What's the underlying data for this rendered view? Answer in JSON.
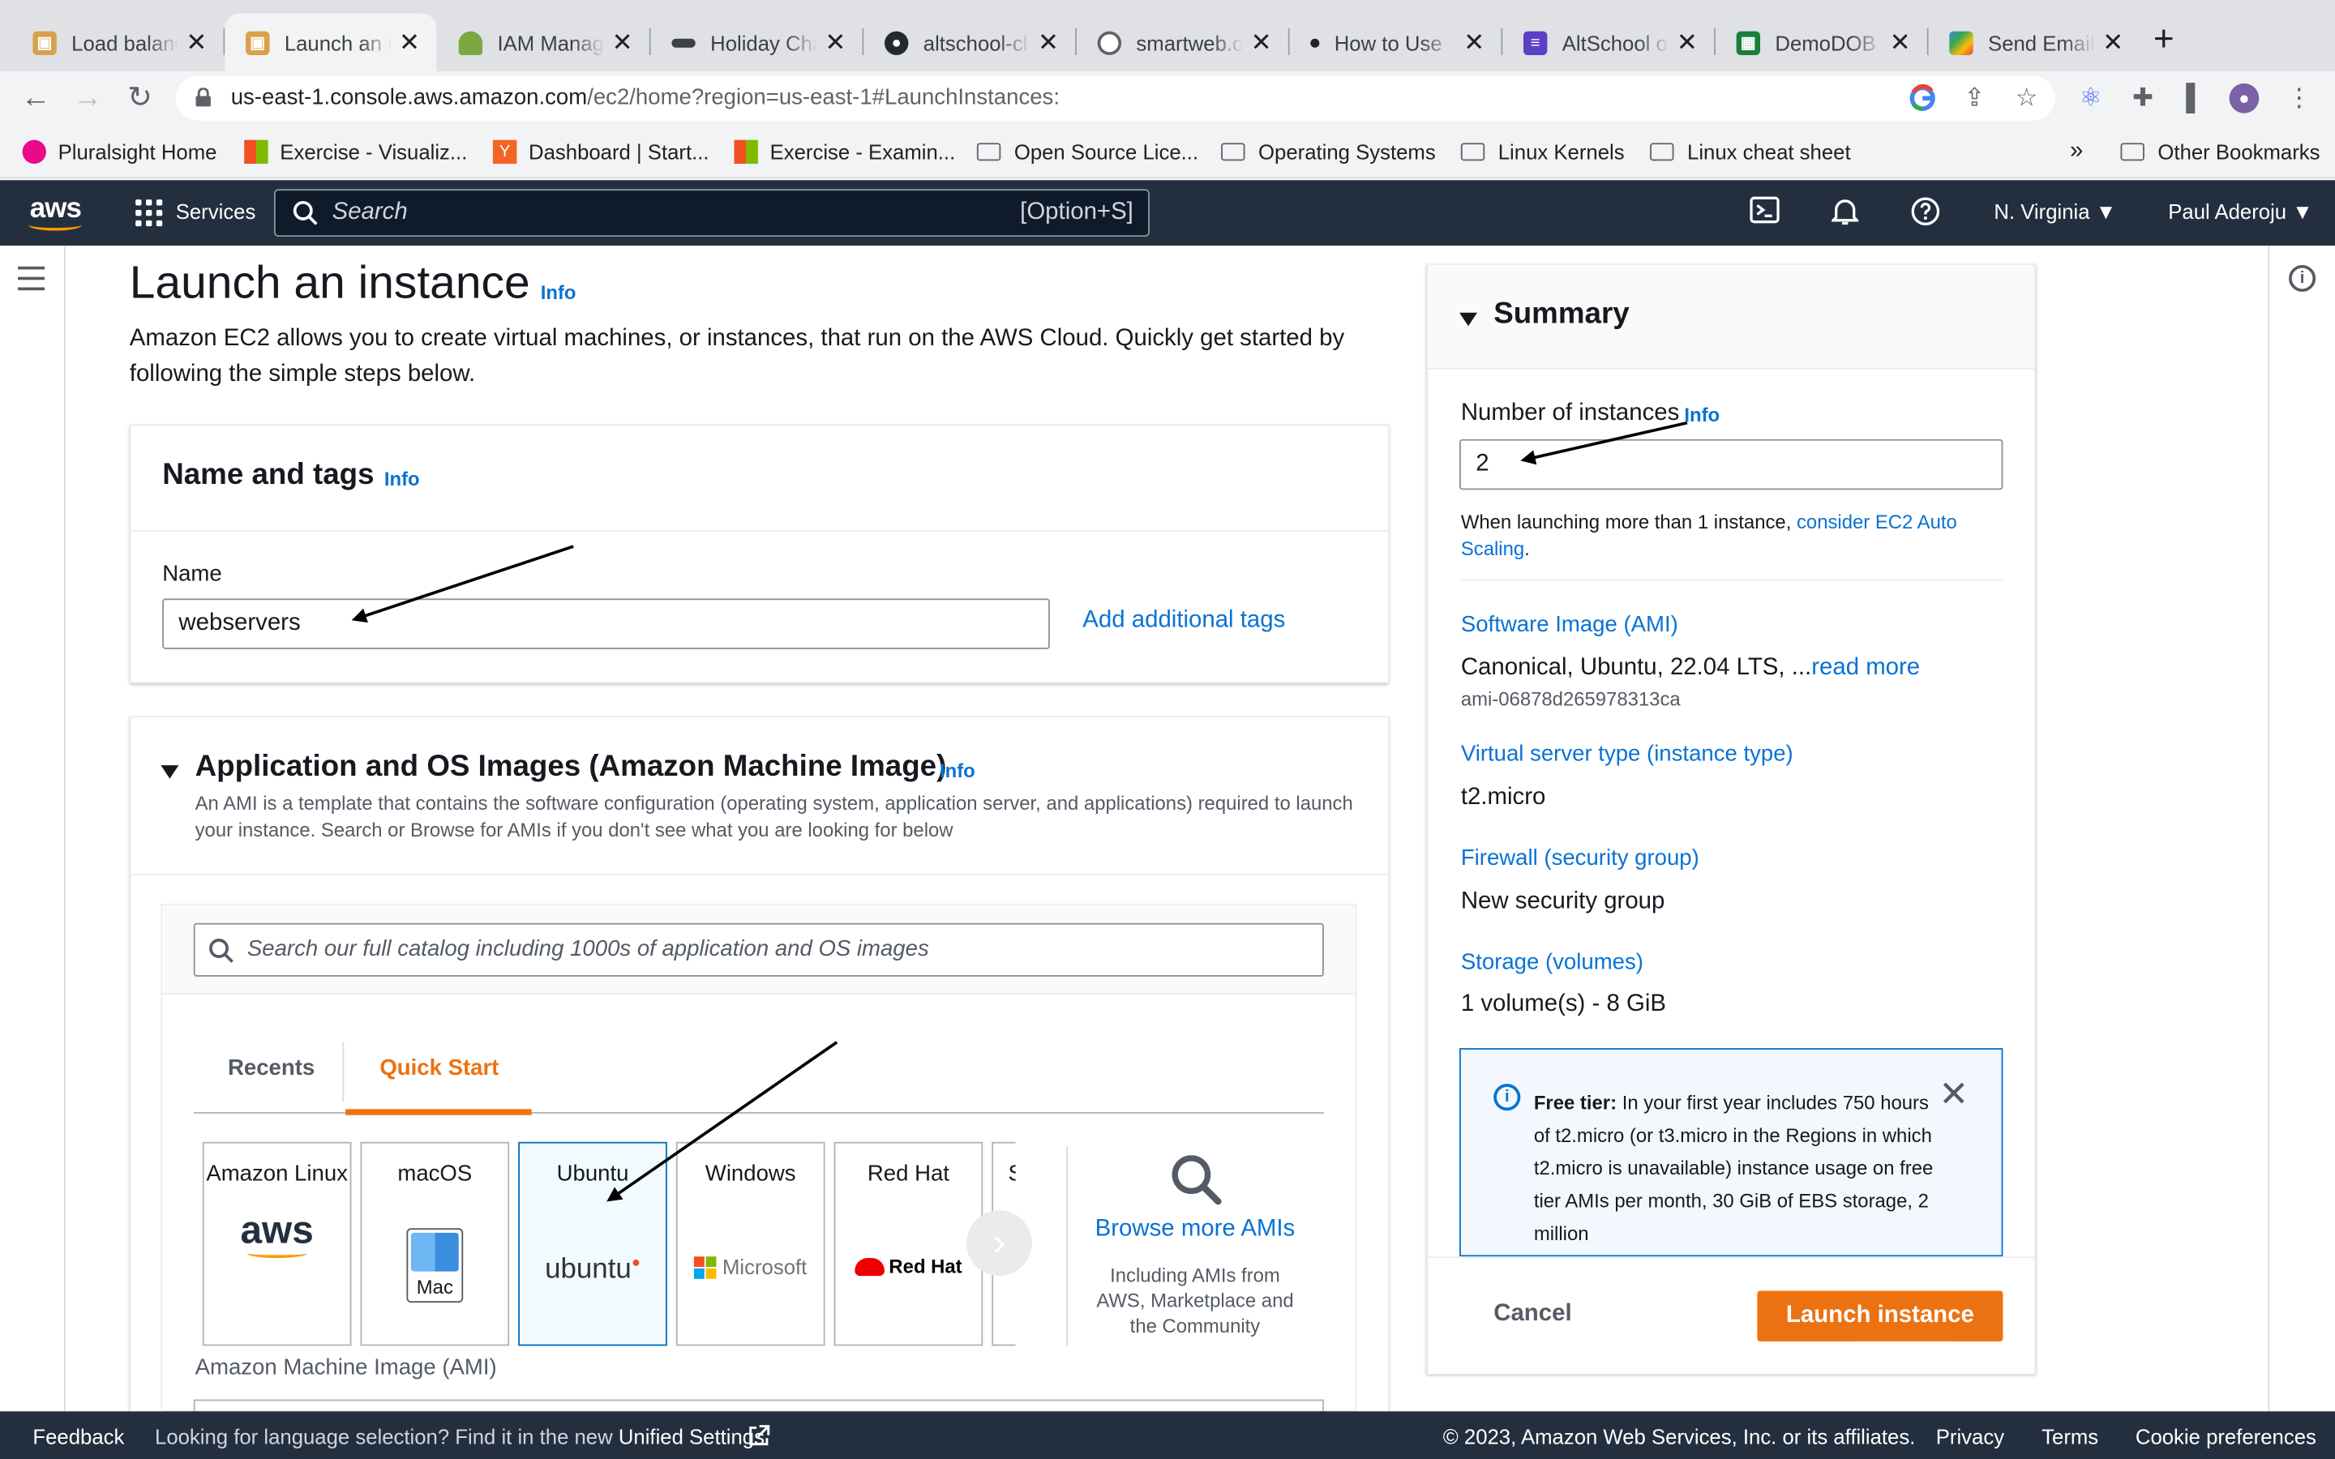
{
  "browser": {
    "tabs": [
      {
        "title": "Load balanc",
        "icon": "aws-box-icon",
        "active": false
      },
      {
        "title": "Launch an i",
        "icon": "aws-box-icon",
        "active": true
      },
      {
        "title": "IAM Manage",
        "icon": "iam-key-icon",
        "active": false
      },
      {
        "title": "Holiday Cha",
        "icon": "holiday-icon",
        "active": false
      },
      {
        "title": "altschool-cl",
        "icon": "github-icon",
        "active": false
      },
      {
        "title": "smartweb.c",
        "icon": "globe-icon",
        "active": false
      },
      {
        "title": "How to Use",
        "icon": "doc-icon",
        "active": false
      },
      {
        "title": "AltSchool o",
        "icon": "altschool-icon",
        "active": false
      },
      {
        "title": "DemoDOB",
        "icon": "sheets-icon",
        "active": false
      },
      {
        "title": "Send Email",
        "icon": "appsheet-icon",
        "active": false
      }
    ],
    "url_host": "us-east-1.console.aws.amazon.com",
    "url_path": "/ec2/home?region=us-east-1#LaunchInstances:",
    "bookmarks": [
      {
        "label": "Pluralsight Home",
        "icon": "pluralsight-icon"
      },
      {
        "label": "Exercise - Visualiz...",
        "icon": "microsoft-icon"
      },
      {
        "label": "Dashboard | Start...",
        "icon": "ycombinator-icon"
      },
      {
        "label": "Exercise - Examin...",
        "icon": "microsoft-icon"
      },
      {
        "label": "Open Source Lice...",
        "icon": "folder-icon"
      },
      {
        "label": "Operating Systems",
        "icon": "folder-icon"
      },
      {
        "label": "Linux Kernels",
        "icon": "folder-icon"
      },
      {
        "label": "Linux cheat sheet",
        "icon": "folder-icon"
      }
    ],
    "bookmarks_more": "»",
    "other_bookmarks": "Other Bookmarks"
  },
  "aws_nav": {
    "logo": "aws",
    "services": "Services",
    "search_placeholder": "Search",
    "search_shortcut": "[Option+S]",
    "region": "N. Virginia",
    "user": "Paul Aderoju"
  },
  "page": {
    "title": "Launch an instance",
    "info": "Info",
    "intro": "Amazon EC2 allows you to create virtual machines, or instances, that run on the AWS Cloud. Quickly get started by following the simple steps below."
  },
  "name_tags": {
    "heading": "Name and tags",
    "info": "Info",
    "name_label": "Name",
    "name_value": "webservers",
    "add_tags": "Add additional tags"
  },
  "ami": {
    "heading": "Application and OS Images (Amazon Machine Image)",
    "info": "Info",
    "description": "An AMI is a template that contains the software configuration (operating system, application server, and applications) required to launch your instance. Search or Browse for AMIs if you don't see what you are looking for below",
    "search_placeholder": "Search our full catalog including 1000s of application and OS images",
    "tabs": [
      "Recents",
      "Quick Start"
    ],
    "active_tab": "Quick Start",
    "os_options": [
      {
        "name": "Amazon Linux",
        "logo": "aws"
      },
      {
        "name": "macOS",
        "logo": "Mac"
      },
      {
        "name": "Ubuntu",
        "logo": "ubuntu"
      },
      {
        "name": "Windows",
        "logo": "Microsoft"
      },
      {
        "name": "Red Hat",
        "logo": "Red Hat"
      },
      {
        "name": "S",
        "logo": ""
      }
    ],
    "selected_os": "Ubuntu",
    "browse_more": "Browse more AMIs",
    "browse_sub": "Including AMIs from AWS, Marketplace and the Community",
    "ami_label": "Amazon Machine Image (AMI)"
  },
  "summary": {
    "heading": "Summary",
    "instances_label": "Number of instances",
    "instances_info": "Info",
    "instances_value": "2",
    "autoscale_text": "When launching more than 1 instance,",
    "autoscale_link": "consider EC2 Auto Scaling",
    "autoscale_end": ".",
    "software_image_label": "Software Image (AMI)",
    "software_image_value": "Canonical, Ubuntu, 22.04 LTS, ...",
    "read_more": "read more",
    "ami_id": "ami-06878d265978313ca",
    "instance_type_label": "Virtual server type (instance type)",
    "instance_type_value": "t2.micro",
    "firewall_label": "Firewall (security group)",
    "firewall_value": "New security group",
    "storage_label": "Storage (volumes)",
    "storage_value": "1 volume(s) - 8 GiB",
    "free_tier_title": "Free tier:",
    "free_tier_text": "In your first year includes 750 hours of t2.micro (or t3.micro in the Regions in which t2.micro is unavailable) instance usage on free tier AMIs per month, 30 GiB of EBS storage, 2 million",
    "cancel": "Cancel",
    "launch": "Launch instance"
  },
  "footer": {
    "feedback": "Feedback",
    "language_note": "Looking for language selection? Find it in the new",
    "unified_settings": "Unified Settings",
    "copyright": "© 2023, Amazon Web Services, Inc. or its affiliates.",
    "privacy": "Privacy",
    "terms": "Terms",
    "cookies": "Cookie preferences"
  },
  "colors": {
    "aws_nav": "#232f3e",
    "aws_orange": "#ec7211",
    "link_blue": "#0972d3",
    "selected_border": "#0073bb"
  }
}
